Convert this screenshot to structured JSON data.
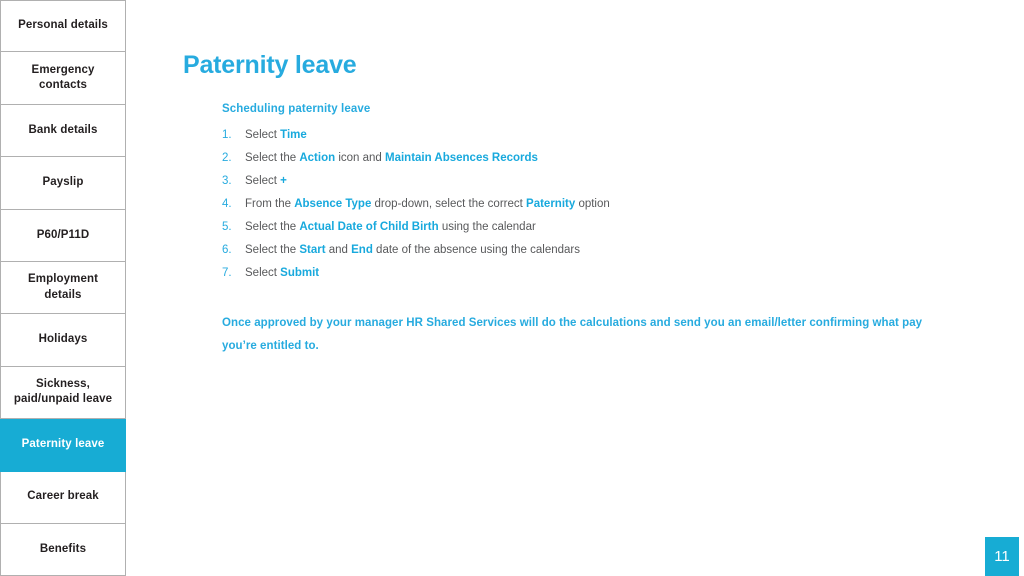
{
  "sidebar": {
    "items": [
      {
        "label": "Personal details",
        "active": false
      },
      {
        "label": "Emergency\ncontacts",
        "active": false
      },
      {
        "label": "Bank details",
        "active": false
      },
      {
        "label": "Payslip",
        "active": false
      },
      {
        "label": "P60/P11D",
        "active": false
      },
      {
        "label": "Employment\ndetails",
        "active": false
      },
      {
        "label": "Holidays",
        "active": false
      },
      {
        "label": "Sickness,\npaid/unpaid leave",
        "active": false
      },
      {
        "label": "Paternity leave",
        "active": true
      },
      {
        "label": "Career break",
        "active": false
      },
      {
        "label": "Benefits",
        "active": false
      }
    ]
  },
  "main": {
    "title": "Paternity leave",
    "subheading": "Scheduling paternity leave",
    "steps": [
      {
        "num": "1.",
        "parts": [
          {
            "t": "Select ",
            "hl": false
          },
          {
            "t": "Time",
            "hl": true
          }
        ]
      },
      {
        "num": "2.",
        "parts": [
          {
            "t": "Select the ",
            "hl": false
          },
          {
            "t": "Action",
            "hl": true
          },
          {
            "t": " icon and ",
            "hl": false
          },
          {
            "t": "Maintain Absences Records",
            "hl": true
          }
        ]
      },
      {
        "num": "3.",
        "parts": [
          {
            "t": "Select ",
            "hl": false
          },
          {
            "t": "+",
            "hl": true
          }
        ]
      },
      {
        "num": "4.",
        "parts": [
          {
            "t": "From the ",
            "hl": false
          },
          {
            "t": "Absence Type",
            "hl": true
          },
          {
            "t": " drop-down, select the correct ",
            "hl": false
          },
          {
            "t": "Paternity",
            "hl": true
          },
          {
            "t": " option",
            "hl": false
          }
        ]
      },
      {
        "num": "5.",
        "parts": [
          {
            "t": "Select the ",
            "hl": false
          },
          {
            "t": "Actual Date of Child Birth",
            "hl": true
          },
          {
            "t": " using the calendar",
            "hl": false
          }
        ]
      },
      {
        "num": "6.",
        "parts": [
          {
            "t": "Select the ",
            "hl": false
          },
          {
            "t": "Start",
            "hl": true
          },
          {
            "t": " and ",
            "hl": false
          },
          {
            "t": "End",
            "hl": true
          },
          {
            "t": " date of the absence using the calendars",
            "hl": false
          }
        ]
      },
      {
        "num": "7.",
        "parts": [
          {
            "t": "Select ",
            "hl": false
          },
          {
            "t": "Submit",
            "hl": true
          }
        ]
      }
    ],
    "closing": "Once approved by your manager HR Shared Services will do the calculations and send you an email/letter confirming what pay you’re entitled to."
  },
  "page_badge": {
    "number": "11"
  },
  "colors": {
    "accent_cyan": "#17acd4",
    "title_cyan": "#27abdf",
    "highlight_cyan": "#18a9dd",
    "body_gray": "#58595b",
    "nav_text": "#231f20",
    "nav_border": "#b0b0b0"
  }
}
